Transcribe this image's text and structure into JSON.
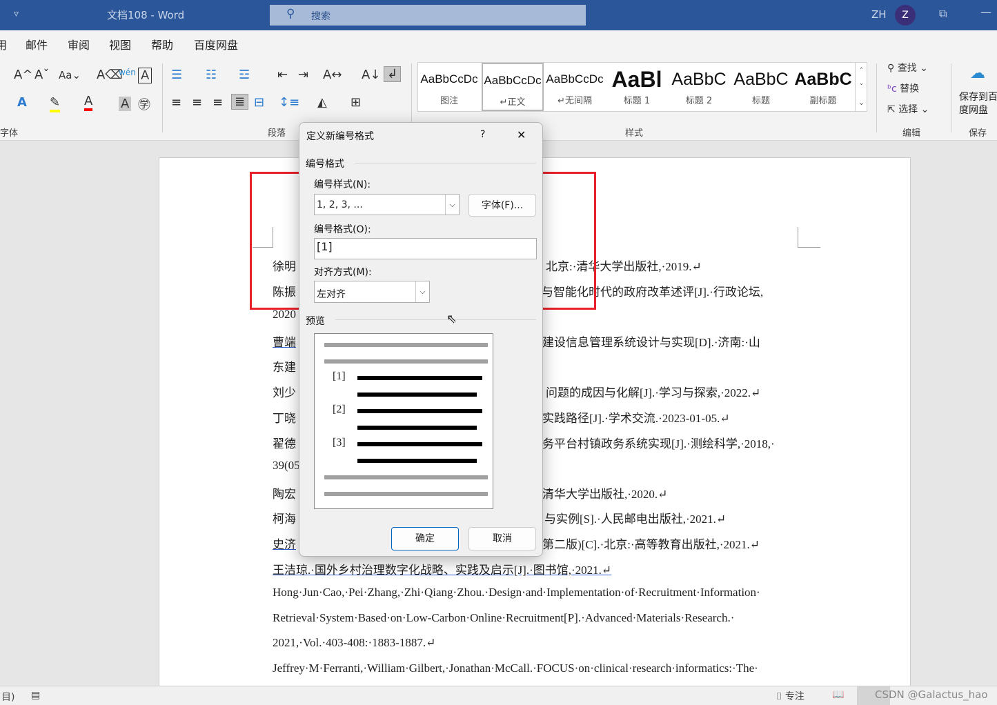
{
  "titlebar": {
    "qat_icon": "customize-qat-chevron",
    "title": "文档108  -  Word",
    "search_placeholder": "搜索",
    "lang": "ZH",
    "avatar": "Z",
    "accent": "#2b579a"
  },
  "tabs": [
    "用",
    "邮件",
    "审阅",
    "视图",
    "帮助",
    "百度网盘"
  ],
  "ribbon": {
    "groups": [
      "字体",
      "段落",
      "样式",
      "编辑",
      "保存"
    ],
    "styles": [
      {
        "sample": "AaBbCcDc",
        "name": "图注"
      },
      {
        "sample": "AaBbCcDc",
        "name": "↵正文"
      },
      {
        "sample": "AaBbCcDc",
        "name": "↵无间隔"
      },
      {
        "sample": "AaBl",
        "name": "标题 1"
      },
      {
        "sample": "AaBbC",
        "name": "标题 2"
      },
      {
        "sample": "AaBbC",
        "name": "标题"
      },
      {
        "sample": "AaBbC",
        "name": "副标题"
      }
    ],
    "editing": {
      "find": "查找",
      "replace": "替换",
      "select": "选择"
    },
    "save": "保存到百度网盘"
  },
  "document": {
    "rows": [
      {
        "left": "徐明",
        "right": "北京:·清华大学出版社,·2019.↵"
      },
      {
        "left": "陈振",
        "right": "与智能化时代的政府改革述评[J].·行政论坛,"
      },
      {
        "left": "2020",
        "right": ""
      },
      {
        "left": "曹端",
        "right": "建设信息管理系统设计与实现[D].·济南:·山"
      },
      {
        "left": "东建",
        "right": ""
      },
      {
        "left": "刘少",
        "right": "问题的成因与化解[J].·学习与探索,·2022.↵"
      },
      {
        "left": "丁晓",
        "right": "实践路径[J].·学术交流.·2023-01-05.↵"
      },
      {
        "left": "翟德",
        "right": "务平台村镇政务系统实现[J].·测绘科学,·2018,·"
      },
      {
        "left": "39(05",
        "right": ""
      },
      {
        "left": "陶宏",
        "right": "清华大学出版社,·2020.↵"
      },
      {
        "left": "柯海",
        "right": "与实例[S].·人民邮电出版社,·2021.↵"
      },
      {
        "left": "史济",
        "right": "第二版)[C].·北京:·高等教育出版社,·2021.↵"
      }
    ],
    "full": [
      "王洁琼.·国外乡村治理数字化战略、实践及启示[J].·图书馆,·2021.↵",
      "Hong·Jun·Cao,·Pei·Zhang,·Zhi·Qiang·Zhou.·Design·and·Implementation·of·Recruitment·Information·",
      "Retrieval·System·Based·on·Low-Carbon·Online·Recruitment[P].·Advanced·Materials·Research.·",
      "2021,·Vol.·403-408:·1883-1887.↵",
      "Jeffrey·M·Ferranti,·William·Gilbert,·Jonathan·McCall.·FOCUS·on·clinical·research·informatics:·The·"
    ]
  },
  "dialog": {
    "title": "定义新编号格式",
    "help": "?",
    "close": "✕",
    "section_format": "编号格式",
    "style_label": "编号样式(N):",
    "style_value": "1, 2, 3, ...",
    "font_button": "字体(F)...",
    "format_label": "编号格式(O):",
    "format_value": "[1]",
    "align_label": "对齐方式(M):",
    "align_value": "左对齐",
    "section_preview": "预览",
    "preview_items": [
      "[1]",
      "[2]",
      "[3]"
    ],
    "ok": "确定",
    "cancel": "取消"
  },
  "status": {
    "focus": "专注",
    "watermark": "CSDN @Galactus_hao"
  },
  "highlight_color": "#e8202a"
}
